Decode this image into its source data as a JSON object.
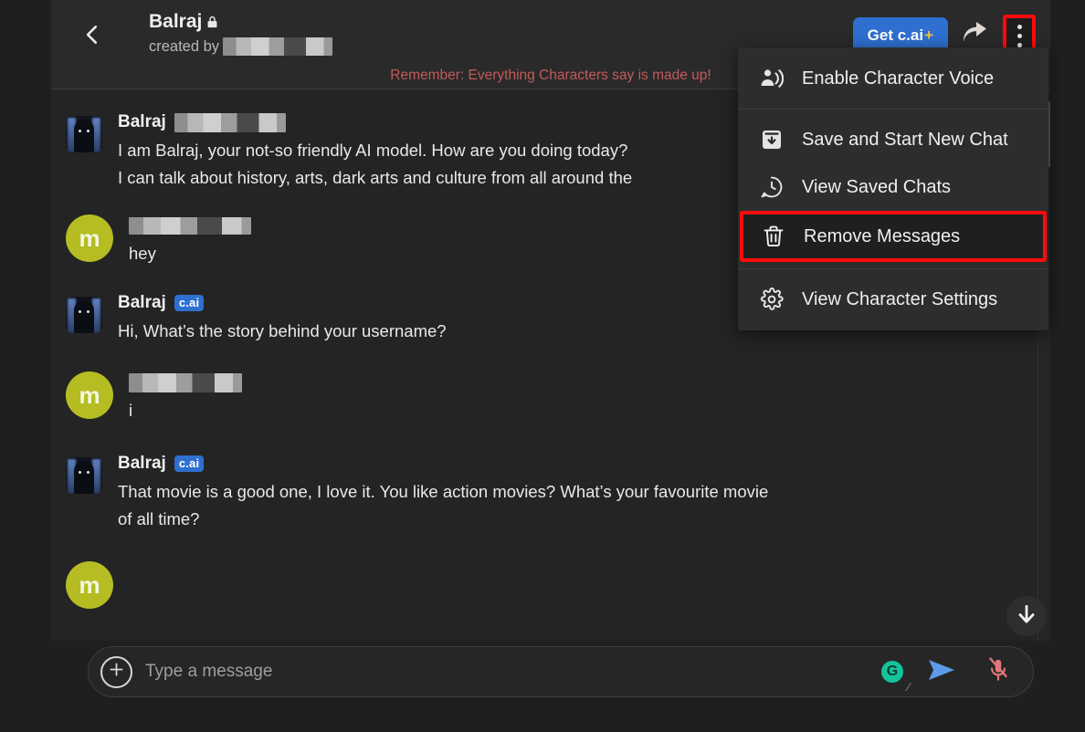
{
  "app": {
    "background_color": "#242424",
    "accent_blue": "#2f6fd0",
    "highlight_red": "#ff0b0b",
    "user_avatar_color": "#b5bd23",
    "warning_color": "#c45a5a"
  },
  "header": {
    "back_icon": "chevron-left-icon",
    "character_name": "Balraj",
    "lock_icon": "lock-icon",
    "created_by_label": "created by",
    "created_by_value_redacted": true,
    "warning_text": "Remember: Everything Characters say is made up!",
    "cai_plus_label": "Get c.ai",
    "cai_plus_suffix": "+",
    "share_icon": "share-arrow-icon",
    "kebab_icon": "more-vertical-icon"
  },
  "menu": {
    "items": [
      {
        "id": "enable-character-voice",
        "icon": "person-voice-icon",
        "label": "Enable Character Voice",
        "highlighted": false
      },
      {
        "id": "save-and-start-new-chat",
        "icon": "save-archive-down-icon",
        "label": "Save and Start New Chat",
        "highlighted": false
      },
      {
        "id": "view-saved-chats",
        "icon": "chat-history-clock-icon",
        "label": "View Saved Chats",
        "highlighted": false
      },
      {
        "id": "remove-messages",
        "icon": "trash-icon",
        "label": "Remove Messages",
        "highlighted": true
      },
      {
        "id": "view-character-settings",
        "icon": "gear-icon",
        "label": "View Character Settings",
        "highlighted": false
      }
    ]
  },
  "chat": {
    "messages": [
      {
        "id": "m1",
        "author": "Balraj",
        "avatar_type": "character",
        "name_badge": "redacted",
        "badge_label": "",
        "text": "I am Balraj, your not-so friendly AI model. How are you doing today?\nI can talk about history, arts, dark arts and culture from all around the"
      },
      {
        "id": "m2",
        "author": "m",
        "avatar_type": "user",
        "avatar_letter": "m",
        "name_badge": "redacted",
        "badge_label": "",
        "text": "hey"
      },
      {
        "id": "m3",
        "author": "Balraj",
        "avatar_type": "character",
        "name_badge": "none",
        "badge_label": "c.ai",
        "text": "Hi, What’s the story behind your username?"
      },
      {
        "id": "m4",
        "author": "m",
        "avatar_type": "user",
        "avatar_letter": "m",
        "name_badge": "redacted",
        "badge_label": "",
        "text": "i"
      },
      {
        "id": "m5",
        "author": "Balraj",
        "avatar_type": "character",
        "name_badge": "none",
        "badge_label": "c.ai",
        "text": "That movie is a good one, I love it. You like action movies? What’s your favourite movie\nof all time?"
      }
    ],
    "scroll_to_bottom_icon": "arrow-down-icon"
  },
  "composer": {
    "add_icon": "plus-circle-icon",
    "placeholder": "Type a message",
    "value": "",
    "grammarly_icon": "grammarly-icon",
    "grammarly_glyph": "G",
    "send_icon": "send-arrow-icon",
    "mic_icon": "microphone-muted-icon",
    "resize_grip": "resize-grip-icon"
  }
}
